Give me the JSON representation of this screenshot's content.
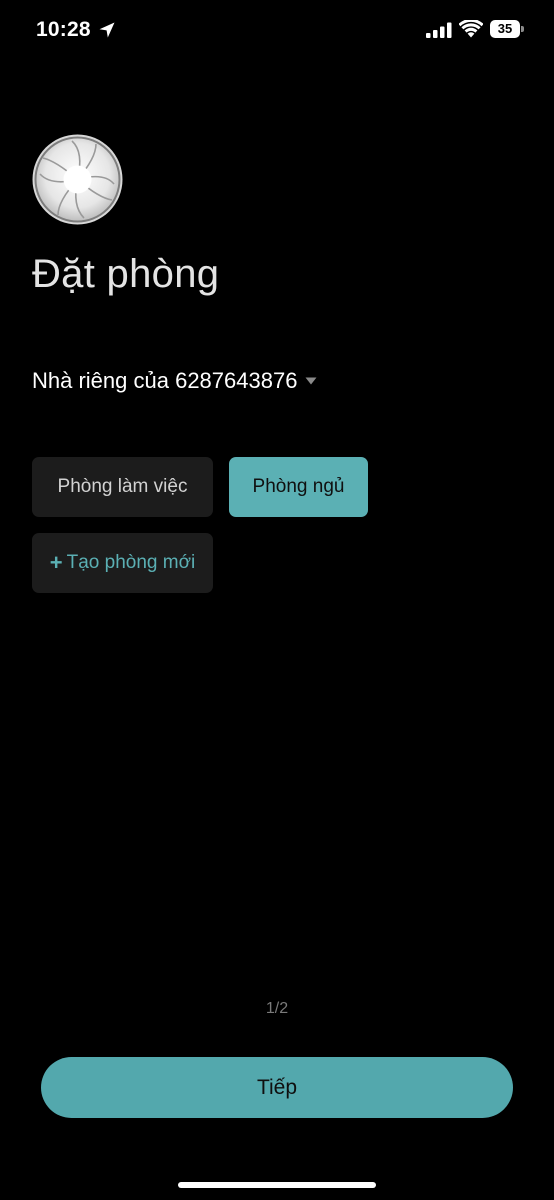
{
  "status_bar": {
    "time": "10:28",
    "battery_level": "35",
    "icons": [
      "location-arrow-icon",
      "cellular-signal-icon",
      "wifi-icon",
      "battery-icon"
    ]
  },
  "device": {
    "image_icon": "fan-icon"
  },
  "page": {
    "title": "Đặt phòng"
  },
  "home_selector": {
    "label": "Nhà riêng của 6287643876",
    "icon": "chevron-down-icon"
  },
  "rooms": {
    "items": [
      {
        "label": "Phòng làm việc",
        "selected": false
      },
      {
        "label": "Phòng ngủ",
        "selected": true
      }
    ],
    "add_new": {
      "plus": "+",
      "label": "Tạo phòng mới"
    }
  },
  "pagination": {
    "indicator": "1/2"
  },
  "footer": {
    "next_label": "Tiếp"
  },
  "colors": {
    "background": "#000000",
    "accent": "#5bb0b4",
    "chip_background": "#1c1c1c"
  }
}
